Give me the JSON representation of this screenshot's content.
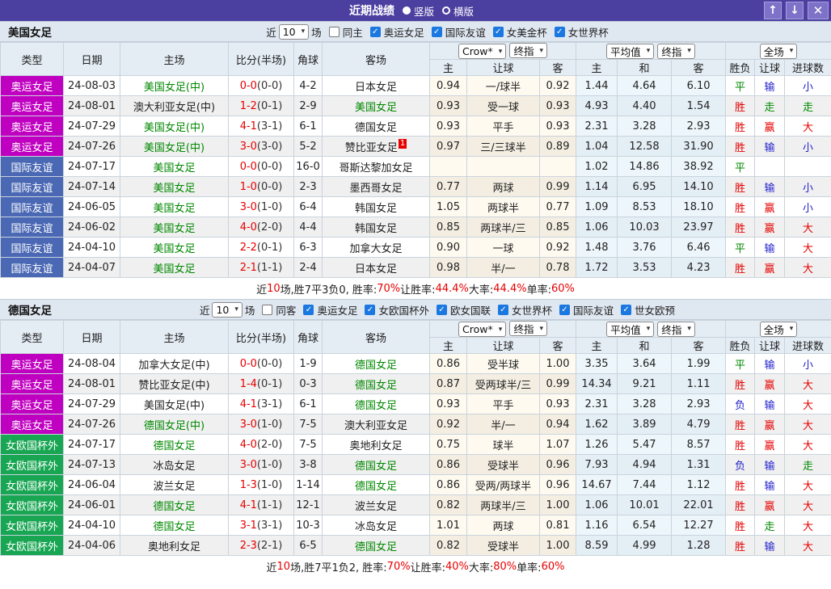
{
  "titlebar": {
    "title": "近期战绩",
    "layout_options": [
      {
        "label": "竖版",
        "selected": true
      },
      {
        "label": "横版",
        "selected": false
      }
    ],
    "buttons": [
      {
        "name": "up-arrow",
        "glyph": "↑"
      },
      {
        "name": "down-arrow",
        "glyph": "↓"
      },
      {
        "name": "close",
        "glyph": "✕"
      }
    ]
  },
  "colors": {
    "titlebar_bg": "#4b3fa0",
    "accent_magenta": "#c000c0",
    "accent_blue": "#4a68b4",
    "accent_green": "#18a653",
    "r": "#e60000",
    "g": "#008800",
    "b": "#2222cc",
    "k": "#222222"
  },
  "table_headers": {
    "left": [
      "类型",
      "日期",
      "主场",
      "比分(半场)",
      "角球",
      "客场"
    ],
    "odds_group_selects": [
      "Crow*",
      "终指"
    ],
    "avg_group_selects": [
      "平均值",
      "终指"
    ],
    "result_group_selects": [
      "全场"
    ],
    "sub": [
      "主",
      "让球",
      "客",
      "主",
      "和",
      "客",
      "胜负",
      "让球",
      "进球数"
    ]
  },
  "sections": [
    {
      "team": "美国女足",
      "filters": {
        "recent_prefix": "近",
        "match_count": "10",
        "recent_suffix": "场",
        "same_venue": {
          "label": "同主",
          "checked": false
        },
        "competitions": [
          {
            "label": "奥运女足",
            "checked": true
          },
          {
            "label": "国际友谊",
            "checked": true
          },
          {
            "label": "女美金杯",
            "checked": true
          },
          {
            "label": "女世界杯",
            "checked": true
          }
        ]
      },
      "rows": [
        {
          "type": "奥运女足",
          "type_color": "accent_magenta",
          "date": "24-08-03",
          "home": "美国女足(中)",
          "home_focus": true,
          "score": "0-0",
          "half": "(0-0)",
          "corner": "4-2",
          "away": "日本女足",
          "away_focus": false,
          "away_badge": "",
          "odds": [
            "0.94",
            "一/球半",
            "0.92"
          ],
          "avg": [
            "1.44",
            "4.64",
            "6.10"
          ],
          "result": {
            "t": "平",
            "c": "g"
          },
          "handicap": {
            "t": "输",
            "c": "b"
          },
          "goals": {
            "t": "小",
            "c": "b"
          }
        },
        {
          "type": "奥运女足",
          "type_color": "accent_magenta",
          "date": "24-08-01",
          "home": "澳大利亚女足(中)",
          "home_focus": false,
          "score": "1-2",
          "half": "(0-1)",
          "corner": "2-9",
          "away": "美国女足",
          "away_focus": true,
          "away_badge": "",
          "odds": [
            "0.93",
            "受一球",
            "0.93"
          ],
          "avg": [
            "4.93",
            "4.40",
            "1.54"
          ],
          "result": {
            "t": "胜",
            "c": "r"
          },
          "handicap": {
            "t": "走",
            "c": "g"
          },
          "goals": {
            "t": "走",
            "c": "g"
          }
        },
        {
          "type": "奥运女足",
          "type_color": "accent_magenta",
          "date": "24-07-29",
          "home": "美国女足(中)",
          "home_focus": true,
          "score": "4-1",
          "half": "(3-1)",
          "corner": "6-1",
          "away": "德国女足",
          "away_focus": false,
          "away_badge": "",
          "odds": [
            "0.93",
            "平手",
            "0.93"
          ],
          "avg": [
            "2.31",
            "3.28",
            "2.93"
          ],
          "result": {
            "t": "胜",
            "c": "r"
          },
          "handicap": {
            "t": "赢",
            "c": "r"
          },
          "goals": {
            "t": "大",
            "c": "r"
          }
        },
        {
          "type": "奥运女足",
          "type_color": "accent_magenta",
          "date": "24-07-26",
          "home": "美国女足(中)",
          "home_focus": true,
          "score": "3-0",
          "half": "(3-0)",
          "corner": "5-2",
          "away": "赞比亚女足",
          "away_focus": false,
          "away_badge": "1",
          "odds": [
            "0.97",
            "三/三球半",
            "0.89"
          ],
          "avg": [
            "1.04",
            "12.58",
            "31.90"
          ],
          "result": {
            "t": "胜",
            "c": "r"
          },
          "handicap": {
            "t": "输",
            "c": "b"
          },
          "goals": {
            "t": "小",
            "c": "b"
          }
        },
        {
          "type": "国际友谊",
          "type_color": "accent_blue",
          "date": "24-07-17",
          "home": "美国女足",
          "home_focus": true,
          "score": "0-0",
          "half": "(0-0)",
          "corner": "16-0",
          "away": "哥斯达黎加女足",
          "away_focus": false,
          "away_badge": "",
          "odds": [
            "",
            "",
            ""
          ],
          "avg": [
            "1.02",
            "14.86",
            "38.92"
          ],
          "result": {
            "t": "平",
            "c": "g"
          },
          "handicap": {
            "t": "",
            "c": "k"
          },
          "goals": {
            "t": "",
            "c": "k"
          }
        },
        {
          "type": "国际友谊",
          "type_color": "accent_blue",
          "date": "24-07-14",
          "home": "美国女足",
          "home_focus": true,
          "score": "1-0",
          "half": "(0-0)",
          "corner": "2-3",
          "away": "墨西哥女足",
          "away_focus": false,
          "away_badge": "",
          "odds": [
            "0.77",
            "两球",
            "0.99"
          ],
          "avg": [
            "1.14",
            "6.95",
            "14.10"
          ],
          "result": {
            "t": "胜",
            "c": "r"
          },
          "handicap": {
            "t": "输",
            "c": "b"
          },
          "goals": {
            "t": "小",
            "c": "b"
          }
        },
        {
          "type": "国际友谊",
          "type_color": "accent_blue",
          "date": "24-06-05",
          "home": "美国女足",
          "home_focus": true,
          "score": "3-0",
          "half": "(1-0)",
          "corner": "6-4",
          "away": "韩国女足",
          "away_focus": false,
          "away_badge": "",
          "odds": [
            "1.05",
            "两球半",
            "0.77"
          ],
          "avg": [
            "1.09",
            "8.53",
            "18.10"
          ],
          "result": {
            "t": "胜",
            "c": "r"
          },
          "handicap": {
            "t": "赢",
            "c": "r"
          },
          "goals": {
            "t": "小",
            "c": "b"
          }
        },
        {
          "type": "国际友谊",
          "type_color": "accent_blue",
          "date": "24-06-02",
          "home": "美国女足",
          "home_focus": true,
          "score": "4-0",
          "half": "(2-0)",
          "corner": "4-4",
          "away": "韩国女足",
          "away_focus": false,
          "away_badge": "",
          "odds": [
            "0.85",
            "两球半/三",
            "0.85"
          ],
          "avg": [
            "1.06",
            "10.03",
            "23.97"
          ],
          "result": {
            "t": "胜",
            "c": "r"
          },
          "handicap": {
            "t": "赢",
            "c": "r"
          },
          "goals": {
            "t": "大",
            "c": "r"
          }
        },
        {
          "type": "国际友谊",
          "type_color": "accent_blue",
          "date": "24-04-10",
          "home": "美国女足",
          "home_focus": true,
          "score": "2-2",
          "half": "(0-1)",
          "corner": "6-3",
          "away": "加拿大女足",
          "away_focus": false,
          "away_badge": "",
          "odds": [
            "0.90",
            "一球",
            "0.92"
          ],
          "avg": [
            "1.48",
            "3.76",
            "6.46"
          ],
          "result": {
            "t": "平",
            "c": "g"
          },
          "handicap": {
            "t": "输",
            "c": "b"
          },
          "goals": {
            "t": "大",
            "c": "r"
          }
        },
        {
          "type": "国际友谊",
          "type_color": "accent_blue",
          "date": "24-04-07",
          "home": "美国女足",
          "home_focus": true,
          "score": "2-1",
          "half": "(1-1)",
          "corner": "2-4",
          "away": "日本女足",
          "away_focus": false,
          "away_badge": "",
          "odds": [
            "0.98",
            "半/一",
            "0.78"
          ],
          "avg": [
            "1.72",
            "3.53",
            "4.23"
          ],
          "result": {
            "t": "胜",
            "c": "r"
          },
          "handicap": {
            "t": "赢",
            "c": "r"
          },
          "goals": {
            "t": "大",
            "c": "r"
          }
        }
      ],
      "summary": [
        {
          "t": "近",
          "red": false
        },
        {
          "t": "10",
          "red": true
        },
        {
          "t": "场,胜7平3负0, 胜率:",
          "red": false
        },
        {
          "t": "70%",
          "red": true
        },
        {
          "t": " 让胜率:",
          "red": false
        },
        {
          "t": "44.4%",
          "red": true
        },
        {
          "t": " 大率:",
          "red": false
        },
        {
          "t": "44.4%",
          "red": true
        },
        {
          "t": " 单率:",
          "red": false
        },
        {
          "t": "60%",
          "red": true
        }
      ]
    },
    {
      "team": "德国女足",
      "filters": {
        "recent_prefix": "近",
        "match_count": "10",
        "recent_suffix": "场",
        "same_venue": {
          "label": "同客",
          "checked": false
        },
        "competitions": [
          {
            "label": "奥运女足",
            "checked": true
          },
          {
            "label": "女欧国杯外",
            "checked": true
          },
          {
            "label": "欧女国联",
            "checked": true
          },
          {
            "label": "女世界杯",
            "checked": true
          },
          {
            "label": "国际友谊",
            "checked": true
          },
          {
            "label": "世女欧预",
            "checked": true
          }
        ]
      },
      "rows": [
        {
          "type": "奥运女足",
          "type_color": "accent_magenta",
          "date": "24-08-04",
          "home": "加拿大女足(中)",
          "home_focus": false,
          "score": "0-0",
          "half": "(0-0)",
          "corner": "1-9",
          "away": "德国女足",
          "away_focus": true,
          "away_badge": "",
          "odds": [
            "0.86",
            "受半球",
            "1.00"
          ],
          "avg": [
            "3.35",
            "3.64",
            "1.99"
          ],
          "result": {
            "t": "平",
            "c": "g"
          },
          "handicap": {
            "t": "输",
            "c": "b"
          },
          "goals": {
            "t": "小",
            "c": "b"
          }
        },
        {
          "type": "奥运女足",
          "type_color": "accent_magenta",
          "date": "24-08-01",
          "home": "赞比亚女足(中)",
          "home_focus": false,
          "score": "1-4",
          "half": "(0-1)",
          "corner": "0-3",
          "away": "德国女足",
          "away_focus": true,
          "away_badge": "",
          "odds": [
            "0.87",
            "受两球半/三",
            "0.99"
          ],
          "avg": [
            "14.34",
            "9.21",
            "1.11"
          ],
          "result": {
            "t": "胜",
            "c": "r"
          },
          "handicap": {
            "t": "赢",
            "c": "r"
          },
          "goals": {
            "t": "大",
            "c": "r"
          }
        },
        {
          "type": "奥运女足",
          "type_color": "accent_magenta",
          "date": "24-07-29",
          "home": "美国女足(中)",
          "home_focus": false,
          "score": "4-1",
          "half": "(3-1)",
          "corner": "6-1",
          "away": "德国女足",
          "away_focus": true,
          "away_badge": "",
          "odds": [
            "0.93",
            "平手",
            "0.93"
          ],
          "avg": [
            "2.31",
            "3.28",
            "2.93"
          ],
          "result": {
            "t": "负",
            "c": "b"
          },
          "handicap": {
            "t": "输",
            "c": "b"
          },
          "goals": {
            "t": "大",
            "c": "r"
          }
        },
        {
          "type": "奥运女足",
          "type_color": "accent_magenta",
          "date": "24-07-26",
          "home": "德国女足(中)",
          "home_focus": true,
          "score": "3-0",
          "half": "(1-0)",
          "corner": "7-5",
          "away": "澳大利亚女足",
          "away_focus": false,
          "away_badge": "",
          "odds": [
            "0.92",
            "半/一",
            "0.94"
          ],
          "avg": [
            "1.62",
            "3.89",
            "4.79"
          ],
          "result": {
            "t": "胜",
            "c": "r"
          },
          "handicap": {
            "t": "赢",
            "c": "r"
          },
          "goals": {
            "t": "大",
            "c": "r"
          }
        },
        {
          "type": "女欧国杯外",
          "type_color": "accent_green",
          "date": "24-07-17",
          "home": "德国女足",
          "home_focus": true,
          "score": "4-0",
          "half": "(2-0)",
          "corner": "7-5",
          "away": "奥地利女足",
          "away_focus": false,
          "away_badge": "",
          "odds": [
            "0.75",
            "球半",
            "1.07"
          ],
          "avg": [
            "1.26",
            "5.47",
            "8.57"
          ],
          "result": {
            "t": "胜",
            "c": "r"
          },
          "handicap": {
            "t": "赢",
            "c": "r"
          },
          "goals": {
            "t": "大",
            "c": "r"
          }
        },
        {
          "type": "女欧国杯外",
          "type_color": "accent_green",
          "date": "24-07-13",
          "home": "冰岛女足",
          "home_focus": false,
          "score": "3-0",
          "half": "(1-0)",
          "corner": "3-8",
          "away": "德国女足",
          "away_focus": true,
          "away_badge": "",
          "odds": [
            "0.86",
            "受球半",
            "0.96"
          ],
          "avg": [
            "7.93",
            "4.94",
            "1.31"
          ],
          "result": {
            "t": "负",
            "c": "b"
          },
          "handicap": {
            "t": "输",
            "c": "b"
          },
          "goals": {
            "t": "走",
            "c": "g"
          }
        },
        {
          "type": "女欧国杯外",
          "type_color": "accent_green",
          "date": "24-06-04",
          "home": "波兰女足",
          "home_focus": false,
          "score": "1-3",
          "half": "(1-0)",
          "corner": "1-14",
          "away": "德国女足",
          "away_focus": true,
          "away_badge": "",
          "odds": [
            "0.86",
            "受两/两球半",
            "0.96"
          ],
          "avg": [
            "14.67",
            "7.44",
            "1.12"
          ],
          "result": {
            "t": "胜",
            "c": "r"
          },
          "handicap": {
            "t": "输",
            "c": "b"
          },
          "goals": {
            "t": "大",
            "c": "r"
          }
        },
        {
          "type": "女欧国杯外",
          "type_color": "accent_green",
          "date": "24-06-01",
          "home": "德国女足",
          "home_focus": true,
          "score": "4-1",
          "half": "(1-1)",
          "corner": "12-1",
          "away": "波兰女足",
          "away_focus": false,
          "away_badge": "",
          "odds": [
            "0.82",
            "两球半/三",
            "1.00"
          ],
          "avg": [
            "1.06",
            "10.01",
            "22.01"
          ],
          "result": {
            "t": "胜",
            "c": "r"
          },
          "handicap": {
            "t": "赢",
            "c": "r"
          },
          "goals": {
            "t": "大",
            "c": "r"
          }
        },
        {
          "type": "女欧国杯外",
          "type_color": "accent_green",
          "date": "24-04-10",
          "home": "德国女足",
          "home_focus": true,
          "score": "3-1",
          "half": "(3-1)",
          "corner": "10-3",
          "away": "冰岛女足",
          "away_focus": false,
          "away_badge": "",
          "odds": [
            "1.01",
            "两球",
            "0.81"
          ],
          "avg": [
            "1.16",
            "6.54",
            "12.27"
          ],
          "result": {
            "t": "胜",
            "c": "r"
          },
          "handicap": {
            "t": "走",
            "c": "g"
          },
          "goals": {
            "t": "大",
            "c": "r"
          }
        },
        {
          "type": "女欧国杯外",
          "type_color": "accent_green",
          "date": "24-04-06",
          "home": "奥地利女足",
          "home_focus": false,
          "score": "2-3",
          "half": "(2-1)",
          "corner": "6-5",
          "away": "德国女足",
          "away_focus": true,
          "away_badge": "",
          "odds": [
            "0.82",
            "受球半",
            "1.00"
          ],
          "avg": [
            "8.59",
            "4.99",
            "1.28"
          ],
          "result": {
            "t": "胜",
            "c": "r"
          },
          "handicap": {
            "t": "输",
            "c": "b"
          },
          "goals": {
            "t": "大",
            "c": "r"
          }
        }
      ],
      "summary": [
        {
          "t": "近",
          "red": false
        },
        {
          "t": "10",
          "red": true
        },
        {
          "t": "场,胜7平1负2, 胜率:",
          "red": false
        },
        {
          "t": "70%",
          "red": true
        },
        {
          "t": " 让胜率:",
          "red": false
        },
        {
          "t": "40%",
          "red": true
        },
        {
          "t": " 大率:",
          "red": false
        },
        {
          "t": "80%",
          "red": true
        },
        {
          "t": " 单率:",
          "red": false
        },
        {
          "t": "60%",
          "red": true
        }
      ]
    }
  ]
}
